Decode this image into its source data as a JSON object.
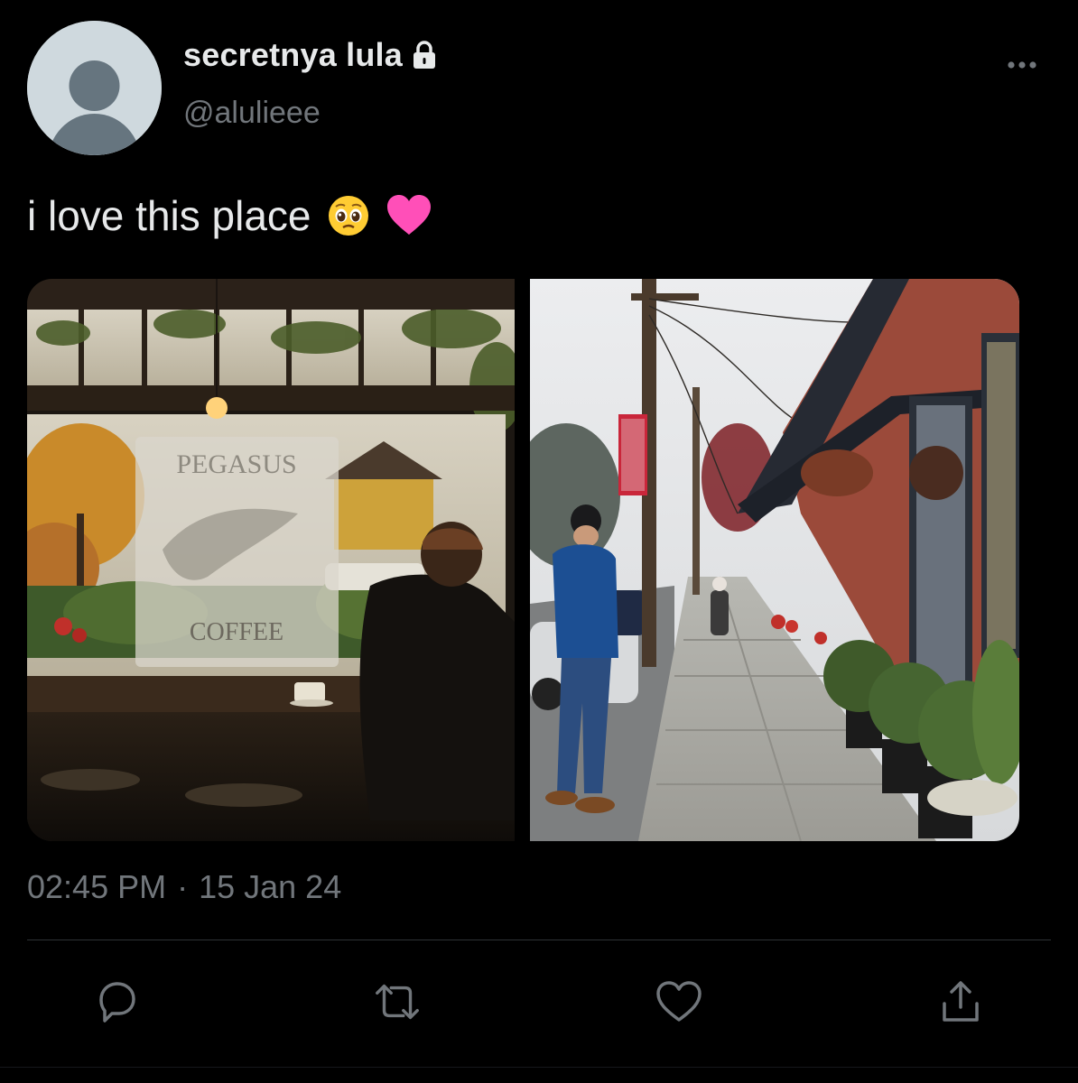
{
  "author": {
    "display_name": "secretnya lula",
    "handle": "@alulieee",
    "protected": true,
    "avatar": "default-avatar-icon"
  },
  "tweet": {
    "text": "i love this place",
    "emojis": [
      "pleading-face-emoji",
      "pink-heart-emoji"
    ]
  },
  "media": {
    "count": 2,
    "photos": [
      {
        "name": "coffee-shop-window-photo",
        "sign_text_top": "PEGASUS",
        "sign_text_bottom": "COFFEE"
      },
      {
        "name": "rainy-street-sidewalk-photo"
      }
    ]
  },
  "meta": {
    "time": "02:45 PM",
    "separator": "·",
    "date": "15 Jan 24"
  },
  "actions": [
    "reply-icon",
    "retweet-icon",
    "like-icon",
    "share-icon"
  ],
  "more_menu": "more-icon",
  "colors": {
    "background": "#000000",
    "text_primary": "#e7e9ea",
    "text_secondary": "#71767b",
    "divider": "#2f3336"
  }
}
